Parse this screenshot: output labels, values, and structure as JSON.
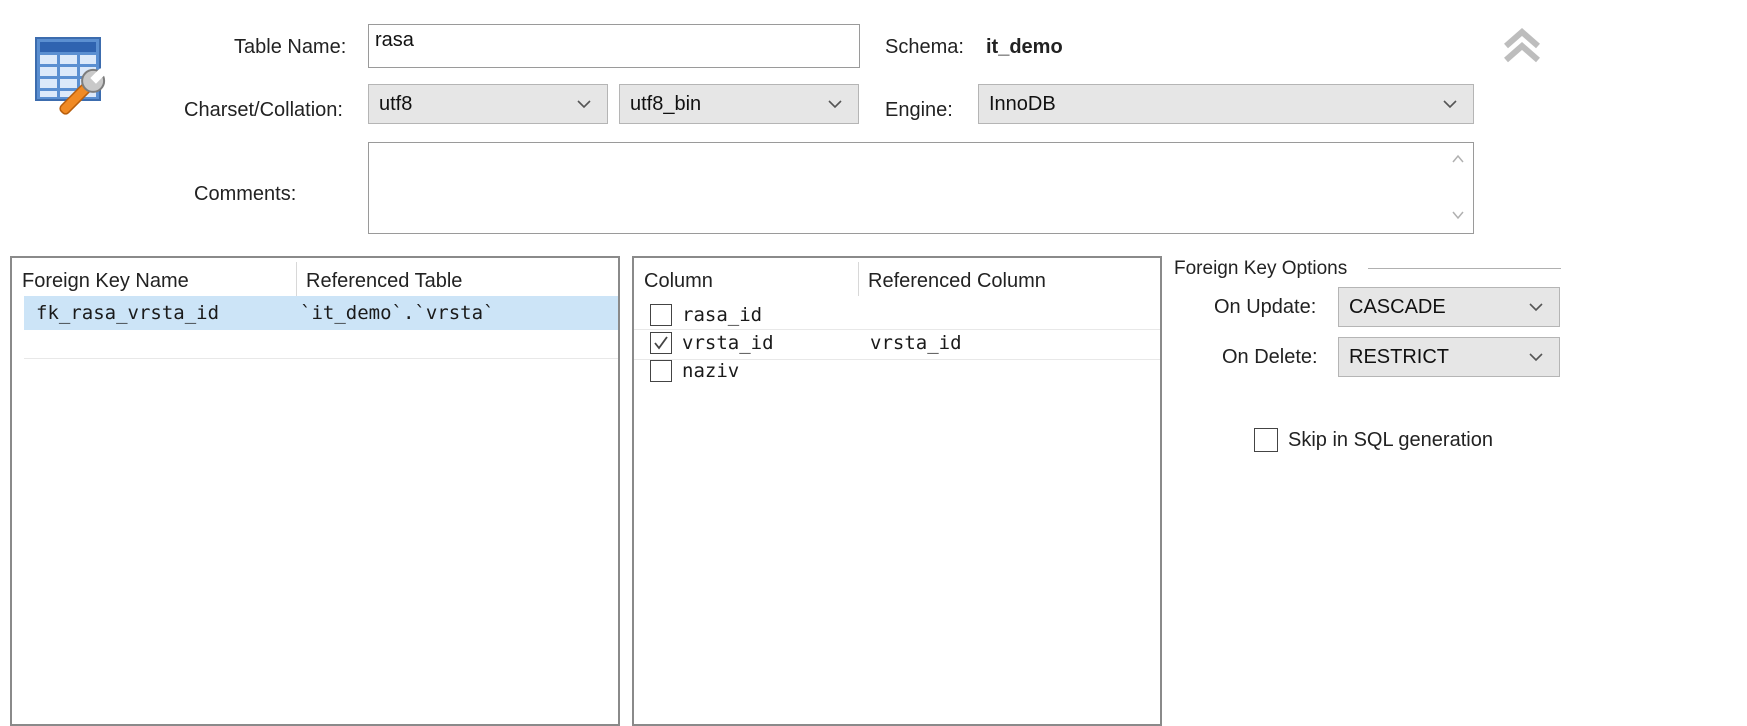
{
  "form": {
    "table_name_label": "Table Name:",
    "table_name_value": "rasa",
    "schema_label": "Schema:",
    "schema_value": "it_demo",
    "charset_label": "Charset/Collation:",
    "charset_value": "utf8",
    "collation_value": "utf8_bin",
    "engine_label": "Engine:",
    "engine_value": "InnoDB",
    "comments_label": "Comments:",
    "comments_value": ""
  },
  "fk_list": {
    "headers": [
      "Foreign Key Name",
      "Referenced Table"
    ],
    "rows": [
      {
        "name": "fk_rasa_vrsta_id",
        "ref_table": "`it_demo`.`vrsta`"
      }
    ]
  },
  "columns": {
    "headers": [
      "Column",
      "Referenced Column"
    ],
    "rows": [
      {
        "column": "rasa_id",
        "checked": false,
        "ref_column": ""
      },
      {
        "column": "vrsta_id",
        "checked": true,
        "ref_column": "vrsta_id"
      },
      {
        "column": "naziv",
        "checked": false,
        "ref_column": ""
      }
    ]
  },
  "fk_options": {
    "title": "Foreign Key Options",
    "on_update_label": "On Update:",
    "on_update_value": "CASCADE",
    "on_delete_label": "On Delete:",
    "on_delete_value": "RESTRICT",
    "skip_sql_label": "Skip in SQL generation",
    "skip_sql_checked": false
  },
  "colors": {
    "selected_row": "#cce4f7",
    "select_bg": "#e6e6e6",
    "border": "#8a8a8a"
  },
  "icons": [
    "table-editor-icon",
    "collapse-chevrons-icon",
    "chevron-down-icon",
    "checkmark-icon"
  ]
}
